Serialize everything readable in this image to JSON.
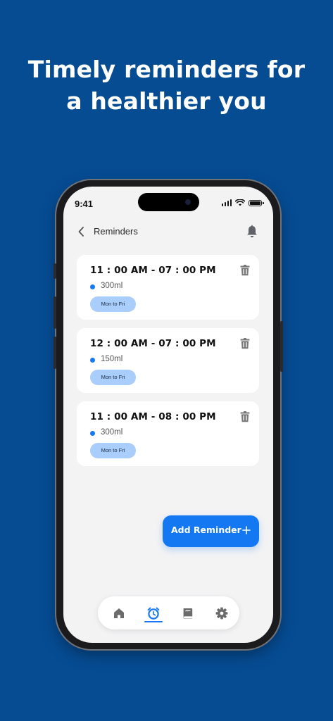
{
  "headline": {
    "line1": "Timely reminders for",
    "line2": "a healthier you"
  },
  "status_bar": {
    "time": "9:41"
  },
  "header": {
    "title": "Reminders",
    "back_icon": "chevron-left-icon",
    "notification_icon": "bell-icon"
  },
  "reminders": [
    {
      "time_range": "11 : 00 AM - 07 : 00 PM",
      "amount": "300ml",
      "days": "Mon to Fri"
    },
    {
      "time_range": "12 : 00 AM - 07 : 00 PM",
      "amount": "150ml",
      "days": "Mon to Fri"
    },
    {
      "time_range": "11 : 00 AM - 08 : 00 PM",
      "amount": "300ml",
      "days": "Mon to Fri"
    }
  ],
  "add_button": {
    "label": "Add Reminder"
  },
  "bottom_nav": {
    "items": [
      "home-icon",
      "alarm-clock-icon",
      "book-icon",
      "gear-icon"
    ],
    "active": "alarm-clock-icon"
  },
  "colors": {
    "background": "#064C93",
    "accent": "#1478F2",
    "chip": "#A9CEFB",
    "screen_bg": "#F3F3F4"
  }
}
